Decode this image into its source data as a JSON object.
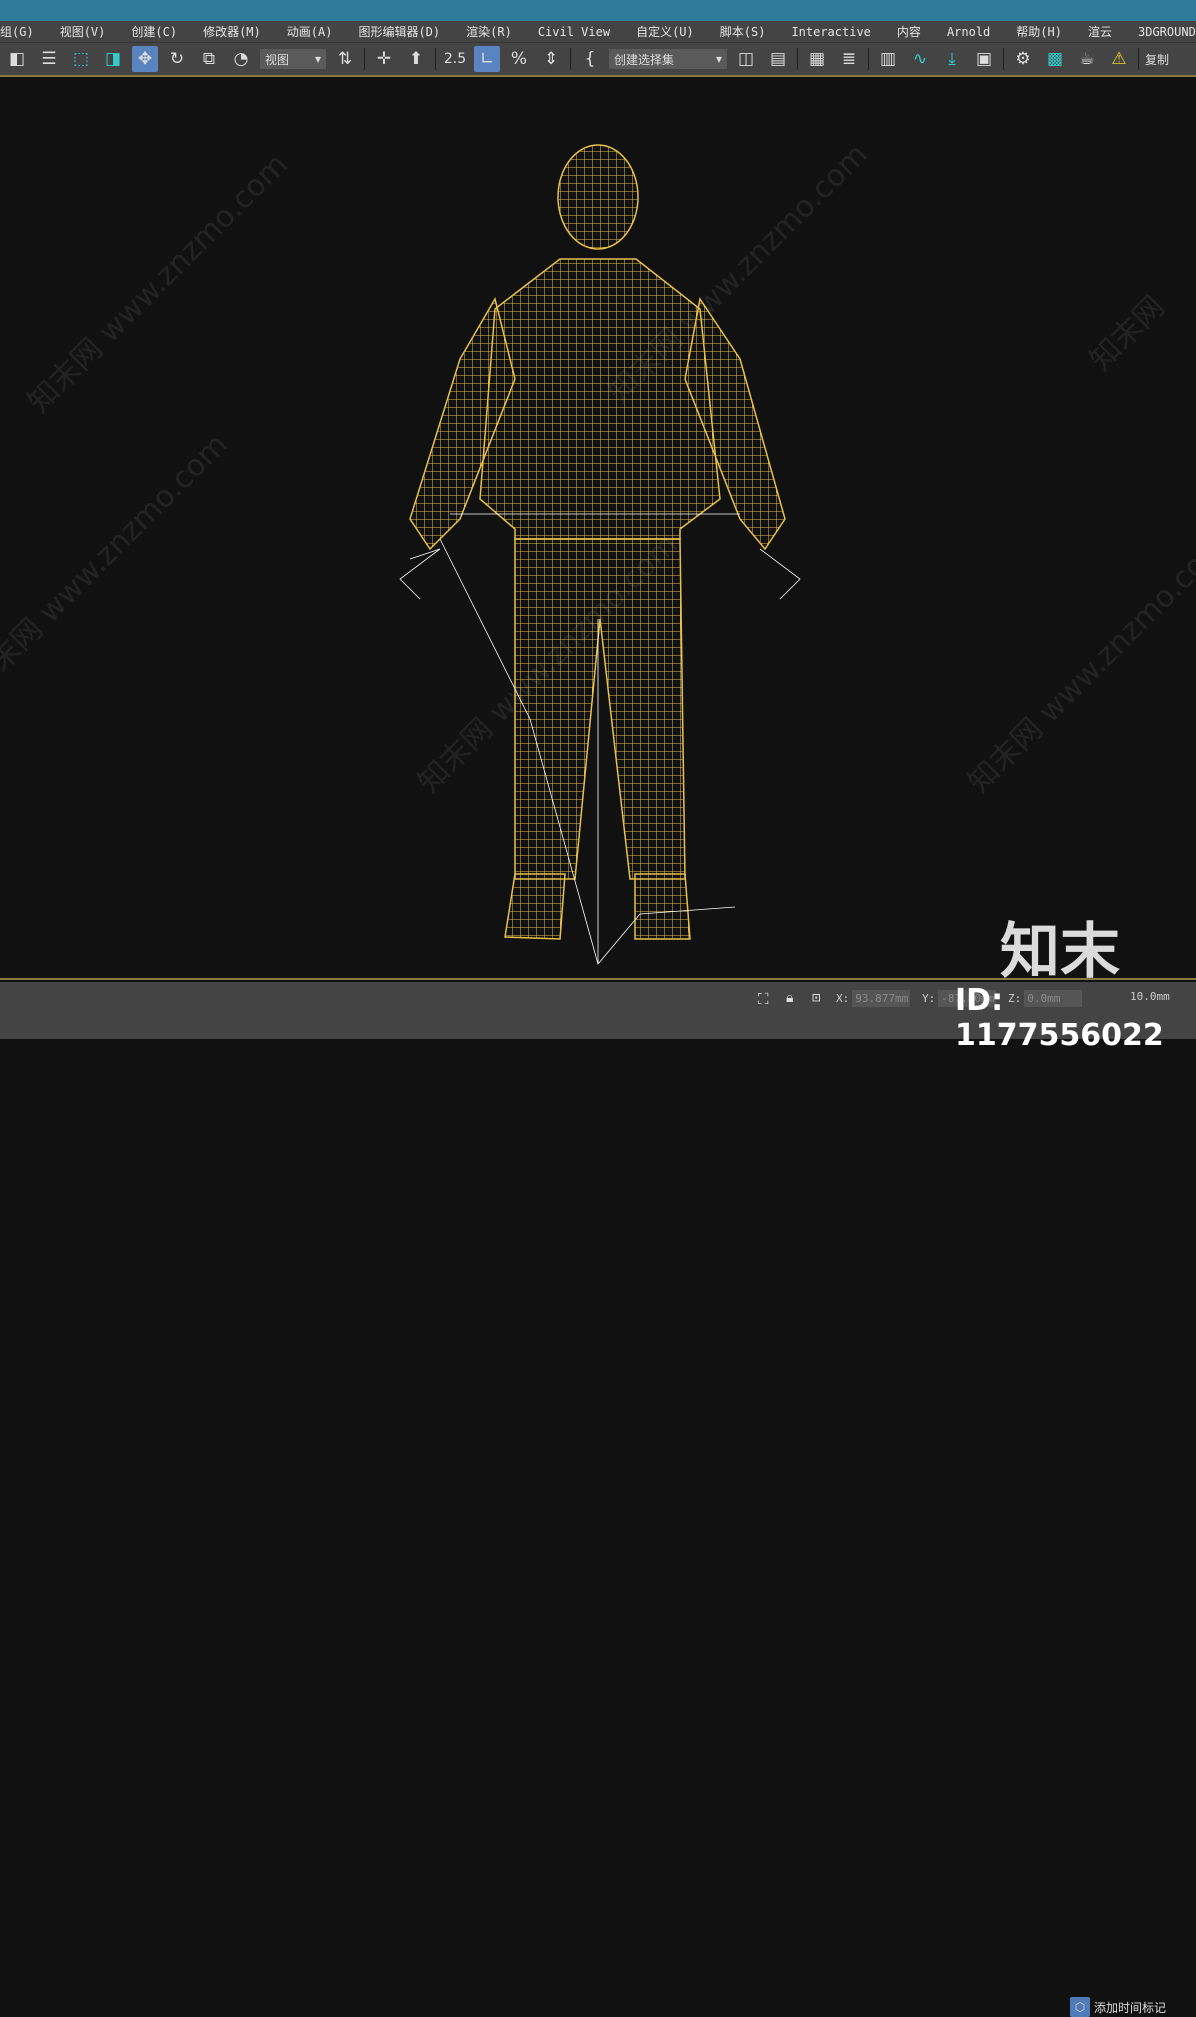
{
  "menu": [
    "组(G)",
    "视图(V)",
    "创建(C)",
    "修改器(M)",
    "动画(A)",
    "图形编辑器(D)",
    "渲染(R)",
    "Civil View",
    "自定义(U)",
    "脚本(S)",
    "Interactive",
    "内容",
    "Arnold",
    "帮助(H)",
    "渲云",
    "3DGROUND"
  ],
  "toolbar": {
    "view_dropdown": "视图",
    "selection_set_dropdown": "创建选择集",
    "copy_label": "复制",
    "snap_label": "2.5"
  },
  "status": {
    "x_label": "X:",
    "x_value": "93.877mm",
    "y_label": "Y:",
    "y_value": "-87.80mm",
    "z_label": "Z:",
    "z_value": "0.0mm",
    "grid_value": "10.0mm",
    "add_time_tag": "添加时间标记"
  },
  "watermark": {
    "text": "知末网 www.znzmo.com",
    "logo": "知末",
    "id": "ID: 1177556022"
  },
  "colors": {
    "titlebar": "#2e7b9a",
    "wireframe": "#e8c04a",
    "active_tool": "#5a84c0",
    "viewport": "#111111"
  }
}
